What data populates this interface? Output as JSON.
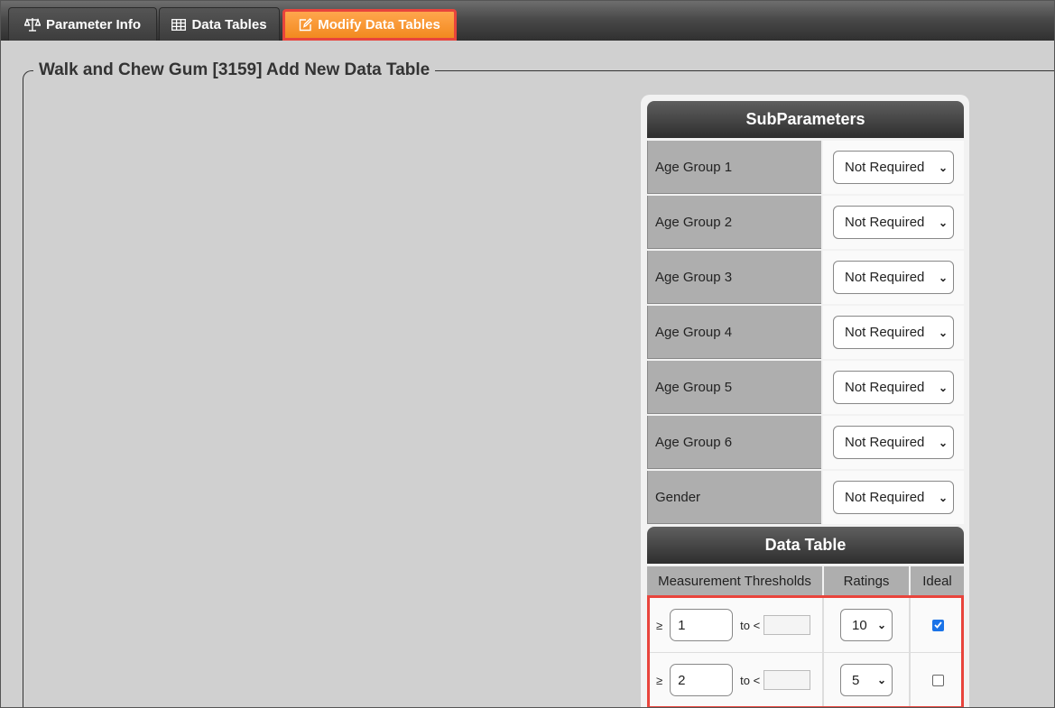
{
  "tabs": [
    {
      "label": "Parameter Info",
      "icon": "balance-scale-icon",
      "active": false
    },
    {
      "label": "Data Tables",
      "icon": "table-icon",
      "active": false
    },
    {
      "label": "Modify Data Tables",
      "icon": "edit-icon",
      "active": true
    }
  ],
  "page": {
    "legend": "Walk and Chew Gum [3159] Add New Data Table"
  },
  "subparameters": {
    "title": "SubParameters",
    "rows": [
      {
        "label": "Age Group 1",
        "value": "Not Required"
      },
      {
        "label": "Age Group 2",
        "value": "Not Required"
      },
      {
        "label": "Age Group 3",
        "value": "Not Required"
      },
      {
        "label": "Age Group 4",
        "value": "Not Required"
      },
      {
        "label": "Age Group 5",
        "value": "Not Required"
      },
      {
        "label": "Age Group 6",
        "value": "Not Required"
      },
      {
        "label": "Gender",
        "value": "Not Required"
      }
    ]
  },
  "data_table": {
    "title": "Data Table",
    "columns": [
      "Measurement Thresholds",
      "Ratings",
      "Ideal"
    ],
    "ge_symbol": "≥",
    "to_lt": "to <",
    "rows": [
      {
        "from": "1",
        "to": "",
        "rating": "10",
        "ideal": true
      },
      {
        "from": "2",
        "to": "",
        "rating": "5",
        "ideal": false
      }
    ]
  },
  "colors": {
    "active_tab": "#f28a1f",
    "highlight": "#e8443c",
    "checkbox_checked": "#1a73e8"
  }
}
